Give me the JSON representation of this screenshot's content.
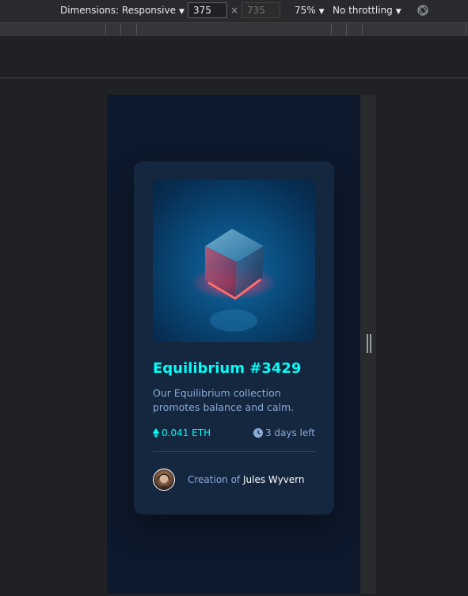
{
  "devtools": {
    "dimensions_label": "Dimensions: Responsive",
    "width_value": "375",
    "height_placeholder": "735",
    "times_sign": "×",
    "zoom_label": "75%",
    "throttle_label": "No throttling",
    "caret": "▼",
    "icons": {
      "rotate": "rotate-icon",
      "dropdown": "caret-down-icon"
    }
  },
  "card": {
    "title": "Equilibrium #3429",
    "description": "Our Equilibrium collection promotes balance and calm.",
    "price": "0.041 ETH",
    "time_left": "3 days left",
    "creator_prefix": "Creation of",
    "creator_name": "Jules Wyvern",
    "icons": {
      "price": "ethereum-icon",
      "time": "clock-icon"
    }
  },
  "colors": {
    "page_bg": "#0d192c",
    "card_bg": "#15263f",
    "accent": "#00fff8",
    "muted_text": "#8bacd9",
    "white": "#ffffff",
    "devtools_bg": "#202124"
  }
}
